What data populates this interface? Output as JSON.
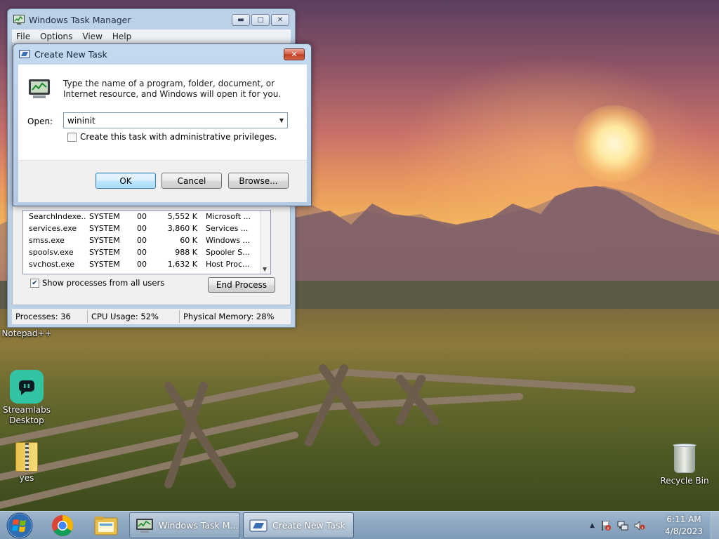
{
  "desktop": {
    "icons": [
      {
        "label": "Notepad++",
        "icon": "notepad-plus-plus-icon"
      },
      {
        "label": "Streamlabs Desktop",
        "icon": "streamlabs-icon"
      },
      {
        "label": "yes",
        "icon": "zip-folder-icon"
      },
      {
        "label": "Recycle Bin",
        "icon": "recycle-bin-icon"
      }
    ]
  },
  "task_manager": {
    "title": "Windows Task Manager",
    "menu": [
      "File",
      "Options",
      "View",
      "Help"
    ],
    "processes": [
      {
        "name": "SearchIndexe...",
        "user": "SYSTEM",
        "cpu": "00",
        "mem": "5,552 K",
        "desc": "Microsoft ..."
      },
      {
        "name": "services.exe",
        "user": "SYSTEM",
        "cpu": "00",
        "mem": "3,860 K",
        "desc": "Services ..."
      },
      {
        "name": "smss.exe",
        "user": "SYSTEM",
        "cpu": "00",
        "mem": "60 K",
        "desc": "Windows ..."
      },
      {
        "name": "spoolsv.exe",
        "user": "SYSTEM",
        "cpu": "00",
        "mem": "988 K",
        "desc": "Spooler S..."
      },
      {
        "name": "svchost.exe",
        "user": "SYSTEM",
        "cpu": "00",
        "mem": "1,632 K",
        "desc": "Host Proc..."
      }
    ],
    "show_all_label": "Show processes from all users",
    "show_all_checked": true,
    "end_process_label": "End Process",
    "status": {
      "processes": "Processes: 36",
      "cpu": "CPU Usage: 52%",
      "memory": "Physical Memory: 28%"
    }
  },
  "dialog": {
    "title": "Create New Task",
    "description": "Type the name of a program, folder, document, or Internet resource, and Windows will open it for you.",
    "open_label": "Open:",
    "open_value": "wininit",
    "admin_label": "Create this task with administrative privileges.",
    "admin_checked": false,
    "ok_label": "OK",
    "cancel_label": "Cancel",
    "browse_label": "Browse..."
  },
  "taskbar": {
    "pinned": [
      "chrome-icon",
      "file-explorer-icon"
    ],
    "tasks": [
      {
        "label": "Windows Task M...",
        "icon": "task-manager-icon"
      },
      {
        "label": "Create New Task",
        "icon": "run-dialog-icon"
      }
    ],
    "time": "6:11 AM",
    "date": "4/8/2023"
  }
}
